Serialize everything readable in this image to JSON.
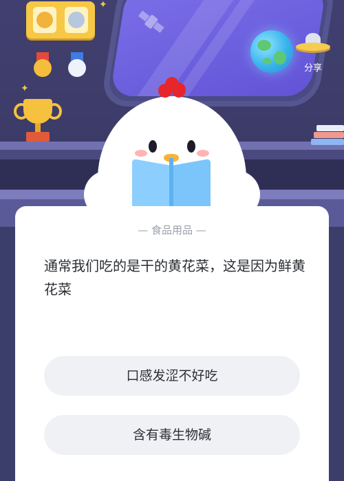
{
  "share": {
    "label": "分享",
    "icon": "ufo-share-icon"
  },
  "quiz": {
    "category": "— 食品用品 —",
    "question": "通常我们吃的是干的黄花菜，这是因为鲜黄花菜",
    "options": [
      {
        "label": "口感发涩不好吃"
      },
      {
        "label": "含有毒生物碱"
      }
    ]
  },
  "colors": {
    "background": "#3d3c69",
    "window_glass": "#6b5fde",
    "comb": "#e6262a",
    "card": "#ffffff",
    "option_bg": "#f0f1f5"
  }
}
